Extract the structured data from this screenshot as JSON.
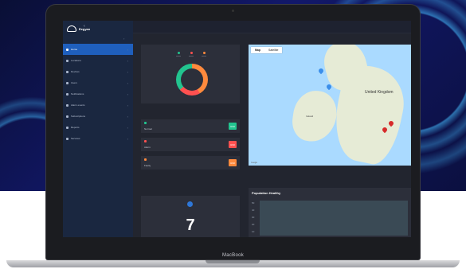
{
  "device": {
    "brand": "MacBook"
  },
  "app": {
    "logo_text": "Eegyan",
    "collapse_icon": "chevron-left-icon"
  },
  "sidebar": {
    "items": [
      {
        "label": "Home",
        "icon": "home-icon",
        "active": true
      },
      {
        "label": "Locations",
        "icon": "location-icon"
      },
      {
        "label": "Devices",
        "icon": "chart-icon"
      },
      {
        "label": "Users",
        "icon": "users-icon"
      },
      {
        "label": "Notifications",
        "icon": "share-icon"
      },
      {
        "label": "Alarm events",
        "icon": "alarm-icon"
      },
      {
        "label": "Subscriptions",
        "icon": "settings-icon"
      },
      {
        "label": "Reports",
        "icon": "report-icon"
      },
      {
        "label": "Services",
        "icon": "trend-icon"
      }
    ]
  },
  "donut": {
    "legend": [
      {
        "color": "#22c48f"
      },
      {
        "color": "#ff5150"
      },
      {
        "color": "#ff8a3d"
      }
    ],
    "segments": [
      {
        "color": "#ff8a3d",
        "share": 0.42
      },
      {
        "color": "#ff5150",
        "share": 0.22
      },
      {
        "color": "#22c48f",
        "share": 0.36
      }
    ]
  },
  "status": [
    {
      "label": "Normal",
      "badge": "0/10",
      "color": "#22c48f"
    },
    {
      "label": "Alarm",
      "badge": "0/10",
      "color": "#ff5150"
    },
    {
      "label": "Faulty",
      "badge": "0/10",
      "color": "#ff8a3d"
    }
  ],
  "count_card": {
    "value": "7"
  },
  "map": {
    "tabs": [
      "Map",
      "Satellite"
    ],
    "labels": {
      "country": "United Kingdom",
      "ireland": "Ireland"
    },
    "footer": "Google"
  },
  "chart": {
    "title": "Population Healthy",
    "yticks": [
      "50",
      "40",
      "30",
      "20",
      "10"
    ]
  }
}
